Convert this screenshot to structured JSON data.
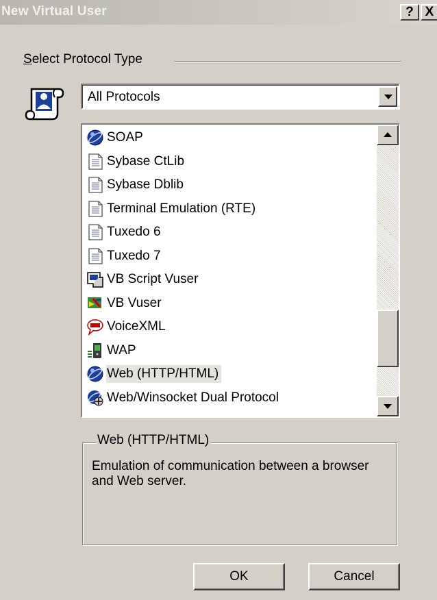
{
  "window": {
    "title": "New Virtual User",
    "help_label": "?",
    "close_label": "X"
  },
  "group": {
    "label_accel": "S",
    "label_rest": "elect Protocol Type"
  },
  "dropdown": {
    "value": "All Protocols"
  },
  "list": {
    "items": [
      {
        "label": "SOAP",
        "icon": "globe-icon"
      },
      {
        "label": "Sybase CtLib",
        "icon": "document-icon"
      },
      {
        "label": "Sybase Dblib",
        "icon": "document-icon"
      },
      {
        "label": "Terminal Emulation (RTE)",
        "icon": "document-icon"
      },
      {
        "label": "Tuxedo 6",
        "icon": "document-icon"
      },
      {
        "label": "Tuxedo 7",
        "icon": "document-icon"
      },
      {
        "label": "VB Script Vuser",
        "icon": "script-icon"
      },
      {
        "label": "VB Vuser",
        "icon": "vb-icon"
      },
      {
        "label": "VoiceXML",
        "icon": "speech-bubble-icon"
      },
      {
        "label": "WAP",
        "icon": "phone-icon"
      },
      {
        "label": "Web (HTTP/HTML)",
        "icon": "globe-icon",
        "selected": true
      },
      {
        "label": "Web/Winsocket Dual Protocol",
        "icon": "globe-network-icon"
      }
    ],
    "scroll_position": 0.85
  },
  "description": {
    "title": "Web (HTTP/HTML)",
    "text": "Emulation of communication between a browser and Web server."
  },
  "buttons": {
    "ok_label": "OK",
    "cancel_label": "Cancel"
  },
  "colors": {
    "face": "#d4d0c8",
    "selected_bg": "#e4e2dc",
    "globe_blue": "#1c3f9a"
  }
}
